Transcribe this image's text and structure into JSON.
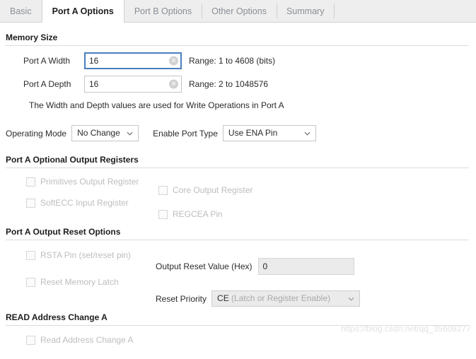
{
  "tabs": [
    {
      "label": "Basic",
      "active": false
    },
    {
      "label": "Port A Options",
      "active": true
    },
    {
      "label": "Port B Options",
      "active": false
    },
    {
      "label": "Other Options",
      "active": false
    },
    {
      "label": "Summary",
      "active": false
    }
  ],
  "memory_size": {
    "title": "Memory Size",
    "width": {
      "label": "Port A Width",
      "value": "16",
      "range": "Range: 1 to 4608 (bits)",
      "clear_icon": "clear-icon"
    },
    "depth": {
      "label": "Port A Depth",
      "value": "16",
      "range": "Range: 2 to 1048576",
      "clear_icon": "clear-icon"
    },
    "note": "The Width and Depth values are used for Write Operations in Port A"
  },
  "mode_row": {
    "operating_mode": {
      "label": "Operating Mode",
      "value": "No Change",
      "caret_icon": "chevron-down-icon"
    },
    "enable_port_type": {
      "label": "Enable Port Type",
      "value": "Use ENA Pin",
      "caret_icon": "chevron-down-icon"
    }
  },
  "optional_output_registers": {
    "title": "Port A Optional Output Registers",
    "checkboxes": [
      {
        "label": "Primitives Output Register",
        "checked": false,
        "disabled": true
      },
      {
        "label": "Core Output Register",
        "checked": false,
        "disabled": true
      },
      {
        "label": "SoftECC Input Register",
        "checked": false,
        "disabled": true
      },
      {
        "label": "REGCEA Pin",
        "checked": false,
        "disabled": true
      }
    ]
  },
  "output_reset_options": {
    "title": "Port A Output Reset Options",
    "checkboxes": [
      {
        "label": "RSTA Pin (set/reset pin)",
        "checked": false,
        "disabled": true
      },
      {
        "label": "Reset Memory Latch",
        "checked": false,
        "disabled": true
      }
    ],
    "reset_value": {
      "label": "Output Reset Value (Hex)",
      "value": "0"
    },
    "reset_priority": {
      "label": "Reset Priority",
      "value_strong": "CE",
      "value_muted": "(Latch or Register Enable)",
      "caret_icon": "chevron-down-icon"
    }
  },
  "read_address_change": {
    "title": "READ Address Change A",
    "checkbox": {
      "label": "Read Address Change A",
      "checked": false,
      "disabled": true
    }
  },
  "watermark": "https://blog.csdn.net/qq_35608277",
  "colors": {
    "tabbar_bg": "#eeeeee",
    "focus_border": "#4a7ebb",
    "rule": "#dcdcdc",
    "disabled_text": "#bdbdbd",
    "text": "#2b2b2b"
  }
}
